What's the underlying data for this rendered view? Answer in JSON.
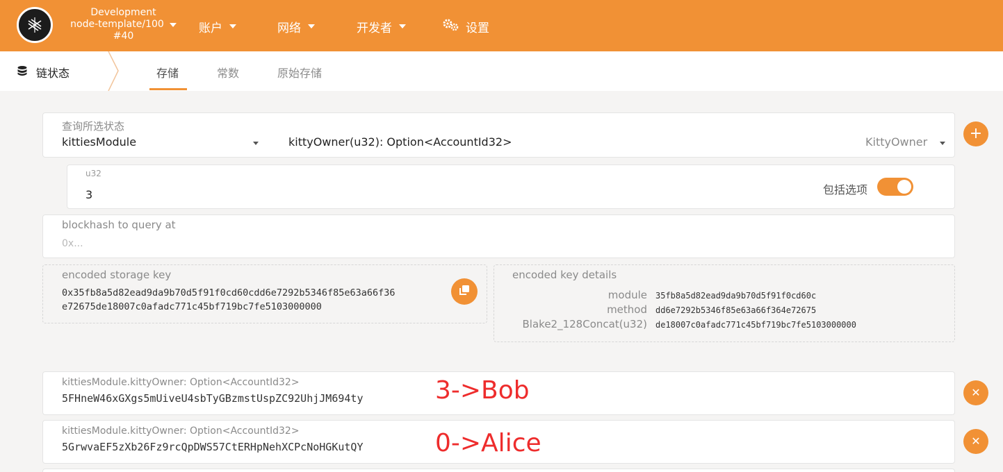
{
  "header": {
    "chain_name": "Development",
    "node_version": "node-template/100",
    "block": "#40",
    "menu": [
      {
        "label": "账户"
      },
      {
        "label": "网络"
      },
      {
        "label": "开发者"
      }
    ],
    "settings_label": "设置",
    "icons": {
      "logo": "substrate-logo-icon",
      "settings": "gears-icon"
    }
  },
  "tabs": {
    "section_label": "链状态",
    "items": [
      "存储",
      "常数",
      "原始存储"
    ],
    "active": "存储"
  },
  "query": {
    "label": "查询所选状态",
    "module": "kittiesModule",
    "method": "kittyOwner(u32): Option<AccountId32>",
    "method_hint": "KittyOwner",
    "param_label": "u32",
    "param_value": "3",
    "include_option_label": "包括选项",
    "include_option": true
  },
  "blockhash": {
    "label": "blockhash to query at",
    "placeholder": "0x..."
  },
  "encoded_key": {
    "label": "encoded storage key",
    "line1": "0x35fb8a5d82ead9da9b70d5f91f0cd60cdd6e7292b5346f85e63a66f36",
    "line2": "e72675de18007c0afadc771c45bf719bc7fe5103000000"
  },
  "key_details": {
    "label": "encoded key details",
    "rows": [
      {
        "key": "module",
        "value": "35fb8a5d82ead9da9b70d5f91f0cd60c"
      },
      {
        "key": "method",
        "value": "dd6e7292b5346f85e63a66f364e72675"
      },
      {
        "key": "Blake2_128Concat(u32)",
        "value": "de18007c0afadc771c45bf719bc7fe5103000000"
      }
    ]
  },
  "results": [
    {
      "title": "kittiesModule.kittyOwner: Option<AccountId32>",
      "value": "5FHneW46xGXgs5mUiveU4sbTyGBzmstUspZC92UhjJM694ty",
      "annotation": "3->Bob"
    },
    {
      "title": "kittiesModule.kittyOwner: Option<AccountId32>",
      "value": "5GrwvaEF5zXb26Fz9rcQpDWS57CtERHpNehXCPcNoHGKutQY",
      "annotation": "0->Alice"
    }
  ],
  "colors": {
    "accent": "#f19135",
    "annotation": "#ee2c2c",
    "background": "#f5f4f3"
  }
}
